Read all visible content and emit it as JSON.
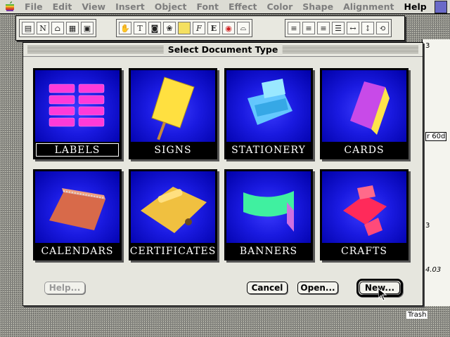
{
  "menubar": {
    "items": [
      {
        "label": "File",
        "enabled": false
      },
      {
        "label": "Edit",
        "enabled": false
      },
      {
        "label": "View",
        "enabled": false
      },
      {
        "label": "Insert",
        "enabled": false
      },
      {
        "label": "Object",
        "enabled": false
      },
      {
        "label": "Font",
        "enabled": false
      },
      {
        "label": "Effect",
        "enabled": false
      },
      {
        "label": "Color",
        "enabled": false
      },
      {
        "label": "Shape",
        "enabled": false
      },
      {
        "label": "Alignment",
        "enabled": false
      },
      {
        "label": "Help",
        "enabled": true
      }
    ]
  },
  "docstrip": {
    "ruler_top": "3",
    "zoom_label": "r 60d",
    "ruler_mid": "3",
    "ruler_bottom": "4.03",
    "trash_label": "Trash"
  },
  "dialog": {
    "title": "Select Document Type",
    "tiles": [
      {
        "label": "LABELS",
        "icon": "labels-icon",
        "selected": true
      },
      {
        "label": "SIGNS",
        "icon": "signs-icon",
        "selected": false
      },
      {
        "label": "STATIONERY",
        "icon": "stationery-icon",
        "selected": false
      },
      {
        "label": "CARDS",
        "icon": "cards-icon",
        "selected": false
      },
      {
        "label": "CALENDARS",
        "icon": "calendars-icon",
        "selected": false
      },
      {
        "label": "CERTIFICATES",
        "icon": "certificates-icon",
        "selected": false
      },
      {
        "label": "BANNERS",
        "icon": "banners-icon",
        "selected": false
      },
      {
        "label": "CRAFTS",
        "icon": "crafts-icon",
        "selected": false
      }
    ],
    "buttons": {
      "help": "Help...",
      "cancel": "Cancel",
      "open": "Open...",
      "new": "New..."
    }
  },
  "colors": {
    "tile_blue": "#1a1ae0",
    "dialog_bg": "#e6e6de"
  }
}
